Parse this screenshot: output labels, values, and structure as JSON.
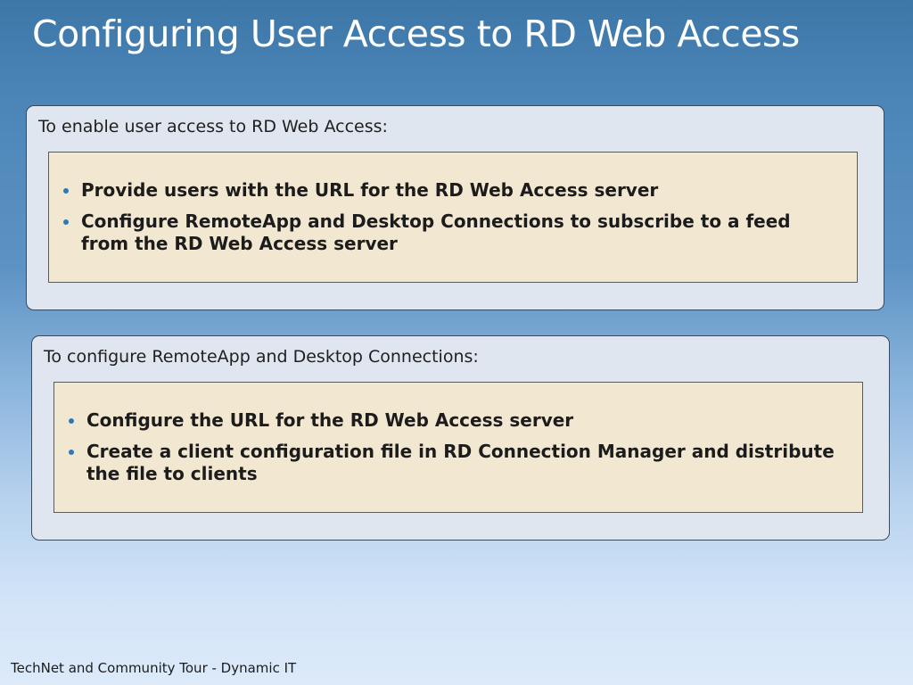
{
  "slide": {
    "title": "Configuring User Access to RD Web Access",
    "footer": "TechNet and Community Tour - Dynamic IT"
  },
  "panels": [
    {
      "intro": "To enable user access to RD Web Access:",
      "bullets": [
        "Provide users with the URL for the RD Web Access server",
        "Configure RemoteApp and Desktop Connections to subscribe to a feed from the RD Web Access server"
      ]
    },
    {
      "intro": "To configure RemoteApp and Desktop Connections:",
      "bullets": [
        "Configure the URL for the RD Web Access server",
        "Create a client configuration file in RD Connection Manager and distribute the file to clients"
      ]
    }
  ],
  "colors": {
    "bullet": "#2e79b8",
    "inner_box": "#f2e7d1",
    "panel": "#dfe6f0",
    "title_text": "#ffffff"
  }
}
